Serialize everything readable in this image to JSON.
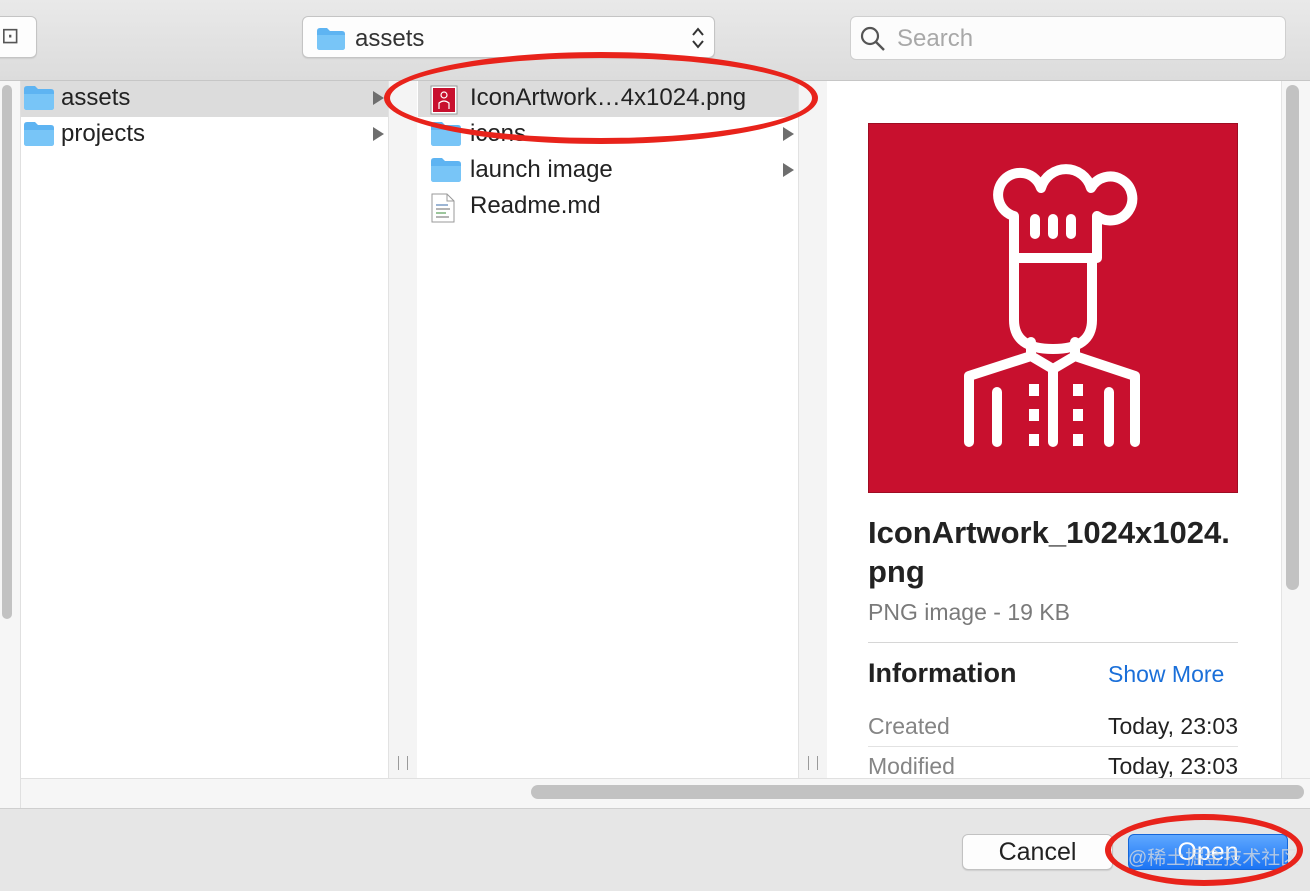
{
  "toolbar": {
    "path_label": "assets",
    "search_placeholder": "Search"
  },
  "column1": {
    "items": [
      {
        "label": "assets",
        "type": "folder",
        "selected": true
      },
      {
        "label": "projects",
        "type": "folder",
        "selected": false
      }
    ]
  },
  "column2": {
    "items": [
      {
        "label": "IconArtwork…4x1024.png",
        "type": "png",
        "selected": true
      },
      {
        "label": "icons",
        "type": "folder",
        "selected": false
      },
      {
        "label": "launch image",
        "type": "folder",
        "selected": false
      },
      {
        "label": "Readme.md",
        "type": "text-document",
        "selected": false
      }
    ]
  },
  "preview": {
    "filename": "IconArtwork_1024x1024.png",
    "kind_size": "PNG image - 19 KB",
    "info_heading": "Information",
    "show_more": "Show More",
    "info": [
      {
        "key": "Created",
        "value": "Today, 23:03"
      },
      {
        "key": "Modified",
        "value": "Today, 23:03"
      }
    ]
  },
  "buttons": {
    "cancel": "Cancel",
    "open": "Open"
  },
  "watermark": "@稀土掘金技术社区",
  "colors": {
    "accent": "#1b74f4",
    "thumbnail_bg": "#c8102e",
    "annotation": "#e8231b",
    "link": "#1a6fd9"
  }
}
